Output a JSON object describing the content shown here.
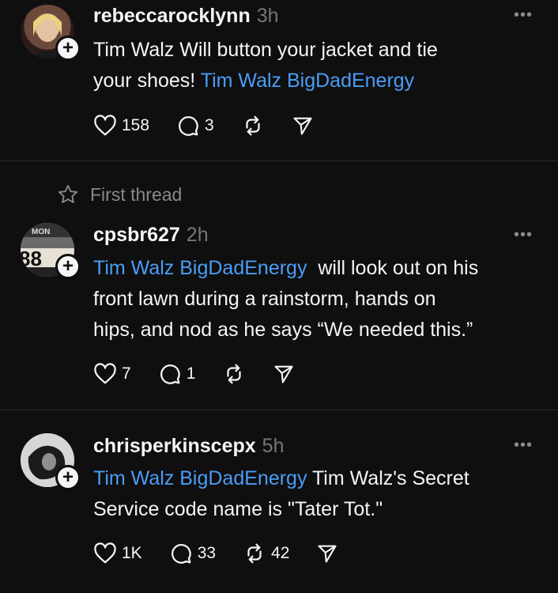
{
  "posts": [
    {
      "username": "rebeccarocklynn",
      "time": "3h",
      "more": "•••",
      "lines": [
        {
          "text": "Tim Walz Will button your jacket and tie"
        },
        {
          "text": "your shoes! ",
          "tag": "Tim Walz BigDadEnergy"
        }
      ],
      "likes": "158",
      "replies": "3"
    },
    {
      "username": "cpsbr627",
      "time": "2h",
      "more": "•••",
      "tag": "Tim Walz BigDadEnergy",
      "line1_rest": "  will look out on his",
      "line2": "front lawn during a rainstorm, hands on",
      "line3": "hips, and nod as he says “We needed this.”",
      "likes": "7",
      "replies": "1"
    },
    {
      "username": "chrisperkinscepx",
      "time": "5h",
      "more": "•••",
      "tag": "Tim Walz BigDadEnergy",
      "line1_rest": " Tim Walz's Secret",
      "line2": "Service code name is \"Tater Tot.\"",
      "likes": "1K",
      "replies": "33",
      "reposts": "42"
    }
  ],
  "thread_label": "First thread",
  "colors": {
    "background": "#0f0f0f",
    "link": "#4a9df8",
    "muted": "#777777"
  }
}
